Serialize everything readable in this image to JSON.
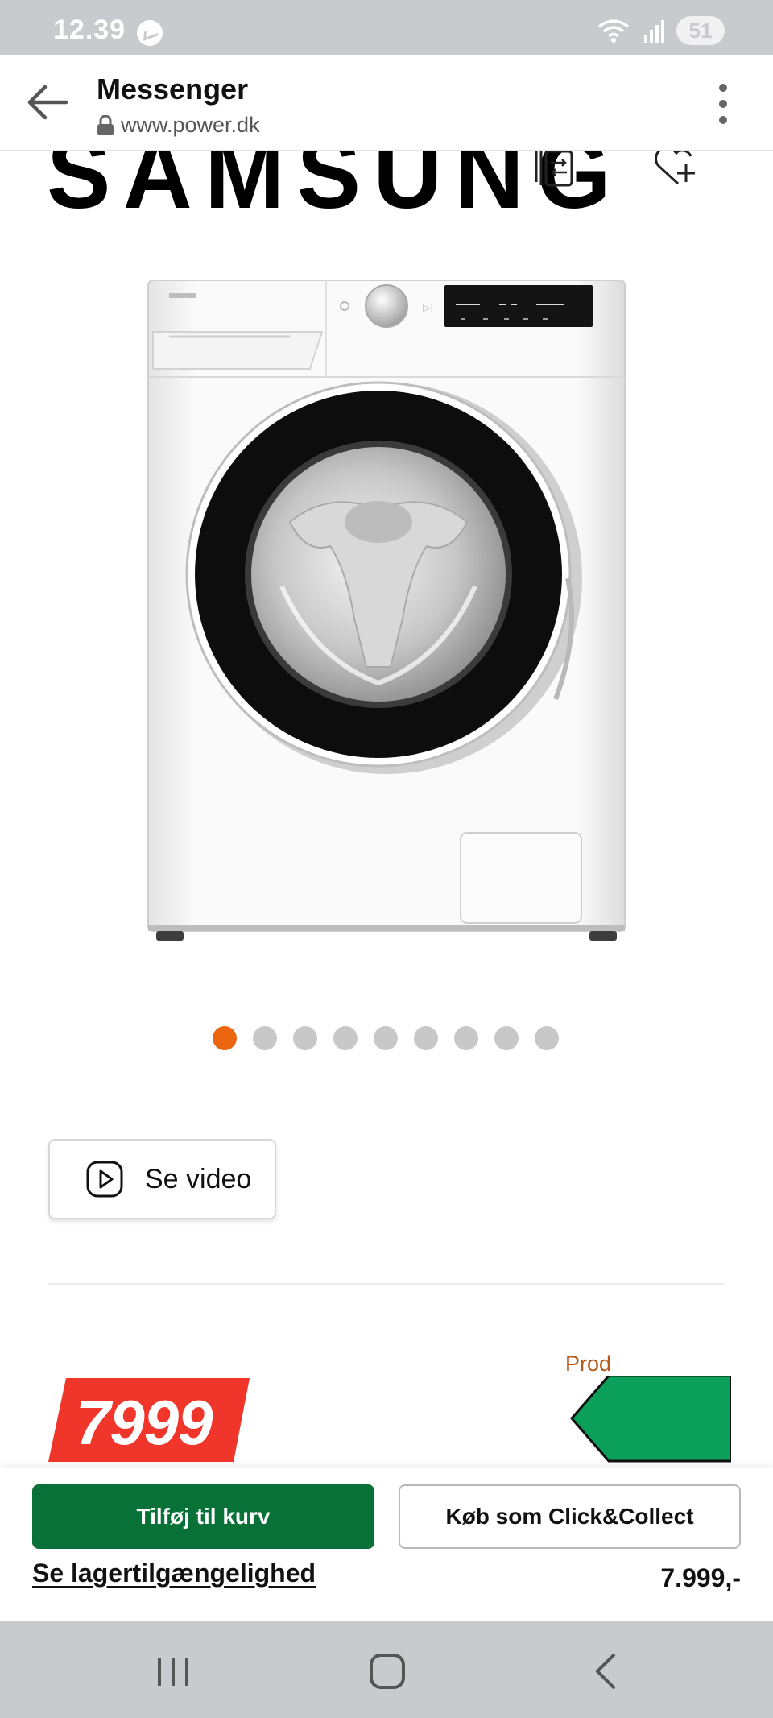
{
  "status_bar": {
    "time": "12.39",
    "battery": "51"
  },
  "browser": {
    "title": "Messenger",
    "url": "www.power.dk"
  },
  "product": {
    "brand": "SAMSUNG",
    "carousel": {
      "total": 9,
      "active_index": 0
    },
    "video_label": "Se video",
    "price_badge": "7999",
    "energy_label_partial": "Prod"
  },
  "actions": {
    "add_to_cart": "Tilføj til kurv",
    "click_collect": "Køb som Click&Collect",
    "stock_link": "Se lagertilgængelighed",
    "price": "7.999,-"
  },
  "colors": {
    "accent_orange": "#ec6611",
    "cart_green": "#087137",
    "price_red": "#f0352a",
    "energy_green": "#0aa05a"
  }
}
